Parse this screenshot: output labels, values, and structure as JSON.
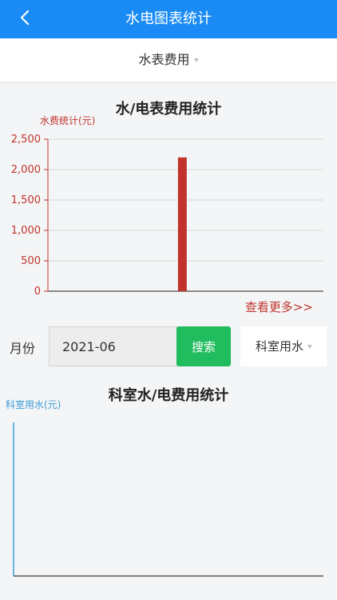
{
  "header": {
    "title": "水电图表统计"
  },
  "type_selector": {
    "value": "水表费用"
  },
  "chart1": {
    "title": "水/电表费用统计"
  },
  "more_link": "查看更多>>",
  "filter": {
    "month_label": "月份",
    "month_value": "2021-06",
    "search_label": "搜索",
    "usage_value": "科室用水"
  },
  "chart2": {
    "title": "科室水/电费用统计"
  },
  "colors": {
    "header": "#1a8bf5",
    "chart1": "#c0332b",
    "chart2": "#3a9bd5",
    "search": "#20bc5e"
  },
  "chart_data": [
    {
      "type": "bar",
      "title": "水/电表费用统计",
      "ylabel": "水费统计(元)",
      "ylim": [
        0,
        2500
      ],
      "yticks": [
        "0",
        "500",
        "1,000",
        "1,500",
        "2,000",
        "2,500"
      ],
      "tick_values": [
        0,
        500,
        1000,
        1500,
        2000,
        2500
      ],
      "bars": [
        {
          "position": 0.488,
          "value": 2200
        }
      ],
      "grid": true,
      "color": "#c0332b"
    },
    {
      "type": "bar",
      "title": "科室水/电费用统计",
      "ylabel": "科室用水(元)",
      "bars": [],
      "grid": false,
      "color": "#3a9bd5"
    }
  ]
}
